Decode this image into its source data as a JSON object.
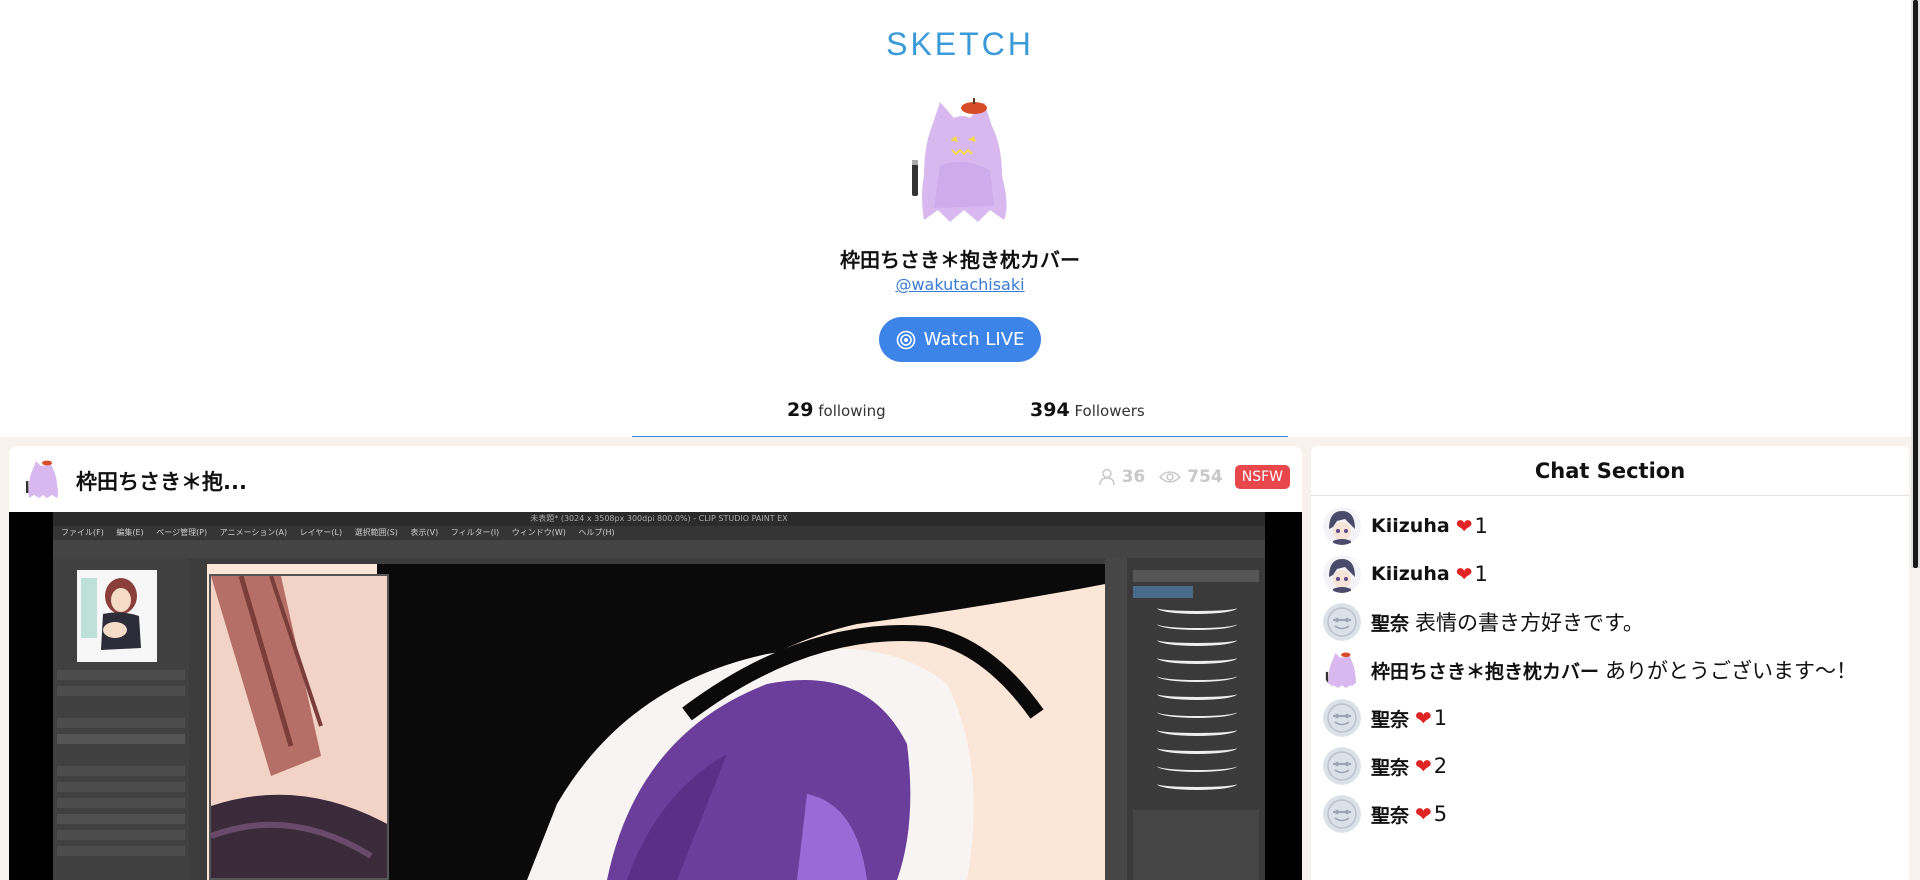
{
  "header": {
    "logo": "SKETCH",
    "profile_name": "枠田ちさき＊抱き枕カバー",
    "handle": "@wakutachisaki",
    "watch_button": "Watch LIVE",
    "following_count": "29",
    "following_label": "following",
    "followers_count": "394",
    "followers_label": "Followers"
  },
  "stream": {
    "title": "枠田ちさき＊抱...",
    "viewers": "36",
    "views": "754",
    "badge": "NSFW",
    "app_title": "未表題* (3024 x 3508px 300dpi 800.0%) - CLIP STUDIO PAINT EX",
    "app_menu": "ファイル(F) 編集(E) ページ管理(P) アニメーション(A) レイヤー(L) 選択範囲(S) 表示(V) フィルター(I) ウィンドウ(W) ヘルプ(H)"
  },
  "chat": {
    "title": "Chat Section",
    "messages": [
      {
        "user": "Kiizuha",
        "type": "heart",
        "count": "1",
        "avatar": "kiizuha"
      },
      {
        "user": "Kiizuha",
        "type": "heart",
        "count": "1",
        "avatar": "kiizuha"
      },
      {
        "user": "聖奈",
        "type": "text",
        "text": "表情の書き方好きです。",
        "avatar": "default"
      },
      {
        "user": "枠田ちさき＊抱き枕カバー",
        "type": "text",
        "text": "ありがとうございます～！",
        "avatar": "ghost"
      },
      {
        "user": "聖奈",
        "type": "heart",
        "count": "1",
        "avatar": "default"
      },
      {
        "user": "聖奈",
        "type": "heart",
        "count": "2",
        "avatar": "default"
      },
      {
        "user": "聖奈",
        "type": "heart",
        "count": "5",
        "avatar": "default"
      }
    ]
  },
  "colors": {
    "accent": "#3d84e8",
    "logo": "#3a9bd8",
    "nsfw": "#e8474c",
    "band": "#f7f2ec",
    "heart": "#e02424"
  }
}
